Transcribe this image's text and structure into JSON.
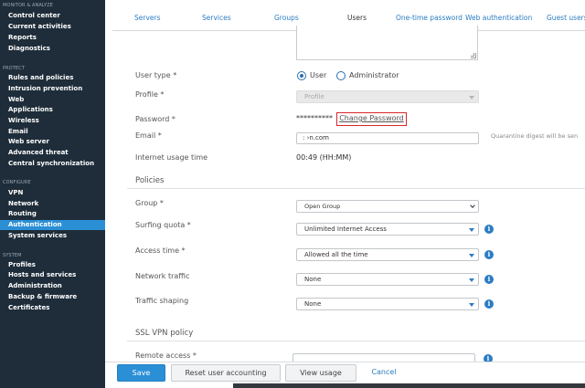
{
  "sidebar": {
    "sections": [
      {
        "title": "MONITOR & ANALYZE",
        "items": [
          "Control center",
          "Current activities",
          "Reports",
          "Diagnostics"
        ]
      },
      {
        "title": "PROTECT",
        "items": [
          "Rules and policies",
          "Intrusion prevention",
          "Web",
          "Applications",
          "Wireless",
          "Email",
          "Web server",
          "Advanced threat",
          "Central synchronization"
        ]
      },
      {
        "title": "CONFIGURE",
        "items": [
          "VPN",
          "Network",
          "Routing",
          "Authentication",
          "System services"
        ]
      },
      {
        "title": "SYSTEM",
        "items": [
          "Profiles",
          "Hosts and services",
          "Administration",
          "Backup & firmware",
          "Certificates"
        ]
      }
    ],
    "active_item": "Authentication"
  },
  "tabs": [
    "Servers",
    "Services",
    "Groups",
    "Users",
    "One-time password",
    "Web authentication",
    "Guest users"
  ],
  "active_tab": "Users",
  "form": {
    "user_type": {
      "label": "User type *",
      "options": [
        "User",
        "Administrator"
      ],
      "selected": "User"
    },
    "profile": {
      "label": "Profile *",
      "placeholder": "Profile"
    },
    "password": {
      "label": "Password *",
      "masked": "**********",
      "change_link": "Change Password"
    },
    "email": {
      "label": "Email *",
      "value": ":                    ›n.com",
      "hint": "Quarantine digest will be sen"
    },
    "internet_usage": {
      "label": "Internet usage time",
      "value": "00:49 (HH:MM)"
    },
    "policies": {
      "title": "Policies",
      "group": {
        "label": "Group *",
        "value": "Open Group"
      },
      "surfing_quota": {
        "label": "Surfing quota *",
        "value": "Unlimited Internet Access"
      },
      "access_time": {
        "label": "Access time *",
        "value": "Allowed all the time"
      },
      "network_traffic": {
        "label": "Network traffic",
        "value": "None"
      },
      "traffic_shaping": {
        "label": "Traffic shaping",
        "value": "None"
      }
    },
    "ssl_vpn": {
      "title": "SSL VPN policy",
      "remote_access": {
        "label": "Remote access *"
      }
    }
  },
  "footer": {
    "save": "Save",
    "reset": "Reset user accounting",
    "view_usage": "View usage",
    "cancel": "Cancel"
  },
  "colors": {
    "sidebar_bg": "#1f2d3a",
    "accent": "#2b8fd6",
    "highlight_box": "#d9262c"
  }
}
